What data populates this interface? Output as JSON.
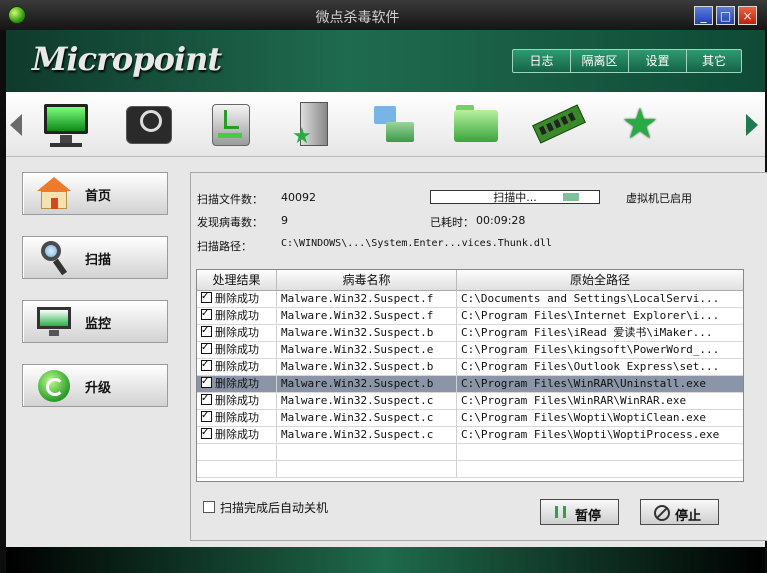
{
  "window": {
    "title": "微点杀毒软件",
    "controls": {
      "minimize": "_",
      "maximize": "□",
      "close": "×"
    }
  },
  "banner": {
    "logo": "Micropoint",
    "nav": [
      "日志",
      "隔离区",
      "设置",
      "其它"
    ]
  },
  "toolbar": {
    "icons": [
      "monitor-icon",
      "scan-disk-icon",
      "usb-drive-icon",
      "door-exit-icon",
      "network-folders-icon",
      "green-folder-icon",
      "memory-chip-icon",
      "green-star-icon"
    ]
  },
  "sidebar": {
    "items": [
      {
        "label": "首页",
        "icon": "home-icon"
      },
      {
        "label": "扫描",
        "icon": "magnifier-icon"
      },
      {
        "label": "监控",
        "icon": "monitor-icon"
      },
      {
        "label": "升级",
        "icon": "update-icon"
      }
    ]
  },
  "scan": {
    "files_label": "扫描文件数：",
    "files_value": "40092",
    "virus_label": "发现病毒数：",
    "virus_value": "9",
    "path_label": "扫描路径：",
    "path_value": "C:\\WINDOWS\\...\\System.Enter...vices.Thunk.dll",
    "status_text": "扫描中...",
    "vm_status": "虚拟机已启用",
    "elapsed_label": "已耗时：",
    "elapsed_value": "00:09:28"
  },
  "table": {
    "headers": [
      "处理结果",
      "病毒名称",
      "原始全路径"
    ],
    "selected_row": 5,
    "rows": [
      {
        "result": "删除成功",
        "name": "Malware.Win32.Suspect.f",
        "path": "C:\\Documents and Settings\\LocalServi..."
      },
      {
        "result": "删除成功",
        "name": "Malware.Win32.Suspect.f",
        "path": "C:\\Program Files\\Internet Explorer\\i..."
      },
      {
        "result": "删除成功",
        "name": "Malware.Win32.Suspect.b",
        "path": "C:\\Program Files\\iRead 爱读书\\iMaker..."
      },
      {
        "result": "删除成功",
        "name": "Malware.Win32.Suspect.e",
        "path": "C:\\Program Files\\kingsoft\\PowerWord_..."
      },
      {
        "result": "删除成功",
        "name": "Malware.Win32.Suspect.b",
        "path": "C:\\Program Files\\Outlook Express\\set..."
      },
      {
        "result": "删除成功",
        "name": "Malware.Win32.Suspect.b",
        "path": "C:\\Program Files\\WinRAR\\Uninstall.exe"
      },
      {
        "result": "删除成功",
        "name": "Malware.Win32.Suspect.c",
        "path": "C:\\Program Files\\WinRAR\\WinRAR.exe"
      },
      {
        "result": "删除成功",
        "name": "Malware.Win32.Suspect.c",
        "path": "C:\\Program Files\\Wopti\\WoptiClean.exe"
      },
      {
        "result": "删除成功",
        "name": "Malware.Win32.Suspect.c",
        "path": "C:\\Program Files\\Wopti\\WoptiProcess.exe"
      }
    ]
  },
  "footer": {
    "auto_shutdown": "扫描完成后自动关机",
    "pause": "暂停",
    "stop": "停止"
  }
}
